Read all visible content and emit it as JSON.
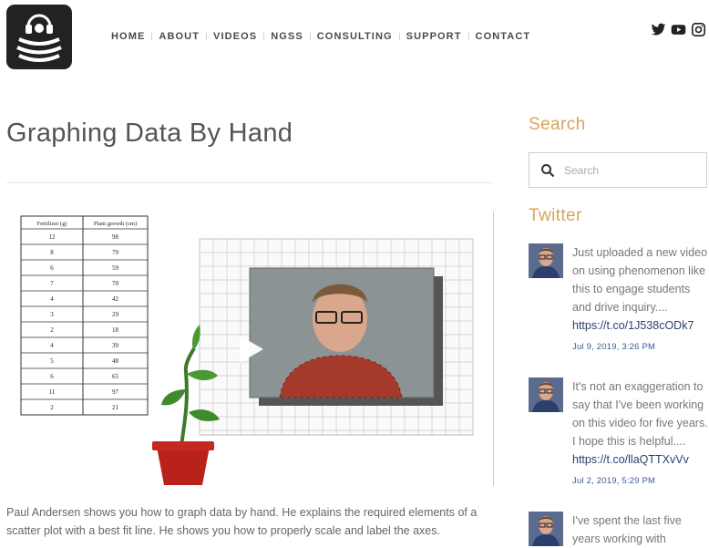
{
  "nav": {
    "items": [
      {
        "label": "HOME"
      },
      {
        "label": "ABOUT"
      },
      {
        "label": "VIDEOS"
      },
      {
        "label": "NGSS"
      },
      {
        "label": "CONSULTING"
      },
      {
        "label": "SUPPORT"
      },
      {
        "label": "CONTACT"
      }
    ]
  },
  "social": {
    "icons": [
      "twitter-icon",
      "youtube-icon",
      "instagram-icon"
    ]
  },
  "post": {
    "title": "Graphing Data By Hand",
    "description": "Paul Andersen shows you how to graph data by hand. He explains the required elements of a scatter plot with a best fit line. He shows you how to properly scale and label the axes.",
    "video_table": {
      "headers": [
        "Fertilizer (g)",
        "Plant growth (cm)"
      ],
      "rows": [
        [
          "12",
          "98"
        ],
        [
          "8",
          "79"
        ],
        [
          "6",
          "59"
        ],
        [
          "7",
          "70"
        ],
        [
          "4",
          "42"
        ],
        [
          "3",
          "29"
        ],
        [
          "2",
          "18"
        ],
        [
          "4",
          "39"
        ],
        [
          "5",
          "48"
        ],
        [
          "6",
          "65"
        ],
        [
          "11",
          "97"
        ],
        [
          "2",
          "21"
        ]
      ]
    }
  },
  "sidebar": {
    "search_title": "Search",
    "search_placeholder": "Search",
    "twitter_title": "Twitter",
    "tweets": [
      {
        "text": "Just uploaded a new video on using phenomenon like this to engage students and drive inquiry....",
        "link": "https://t.co/1J538cODk7",
        "date": "Jul 9, 2019, 3:26 PM"
      },
      {
        "text": "It's not an exaggeration to say that I've been working on this video for five years. I hope this is helpful....",
        "link": "https://t.co/llaQTTXvVv",
        "date": "Jul 2, 2019, 5:29 PM"
      },
      {
        "text": "I've spent the last five years working with",
        "link": "",
        "date": ""
      }
    ]
  },
  "colors": {
    "accent": "#d8a55a",
    "link": "#2c3e6e",
    "date": "#3b5998"
  }
}
